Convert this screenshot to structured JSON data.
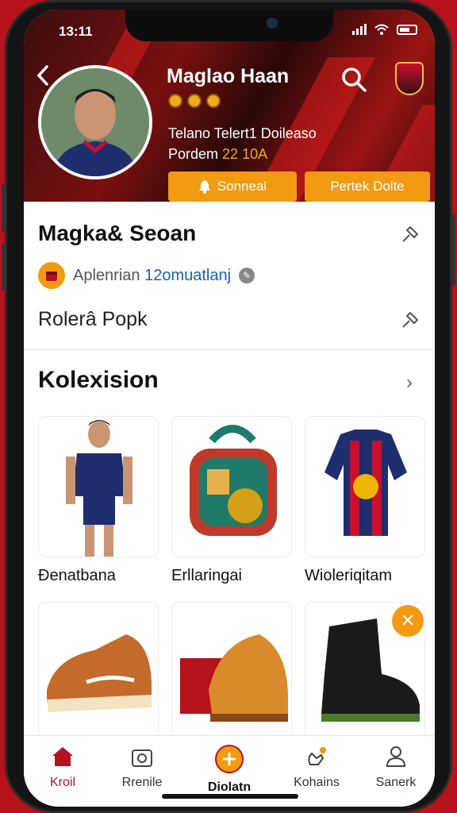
{
  "status": {
    "time": "13:11"
  },
  "profile": {
    "name": "Maglao Haan",
    "info_line1": "Telano Telert1 Doileaso",
    "info_label": "Pordem",
    "info_value": "22 10A",
    "primary_button": "Sonneal",
    "secondary_button": "Pertek Dolte"
  },
  "detail": {
    "title": "Magka& Seoan",
    "meta_label": "Aplenrian",
    "meta_value": "12omuatlanj",
    "subtitle": "Rolerâ Popk"
  },
  "collection": {
    "title": "Kolexision",
    "items": [
      {
        "label": "Đenatbana",
        "icon": "player-image"
      },
      {
        "label": "Erllaringai",
        "icon": "medal-bag-image"
      },
      {
        "label": "Wioleriqitam",
        "icon": "jersey-image"
      },
      {
        "label": "",
        "icon": "sneaker-image"
      },
      {
        "label": "",
        "icon": "boots-box-image"
      },
      {
        "label": "",
        "icon": "black-boot-image"
      }
    ]
  },
  "tabs": [
    {
      "label": "Kroil",
      "icon": "home-icon",
      "active": true
    },
    {
      "label": "Rrenile",
      "icon": "camera-icon",
      "active": false
    },
    {
      "label": "Diolatn",
      "icon": "plus-circle-icon",
      "active": false
    },
    {
      "label": "Kohains",
      "icon": "hand-bell-icon",
      "active": false
    },
    {
      "label": "Sanerk",
      "icon": "person-icon",
      "active": false
    }
  ],
  "colors": {
    "accent": "#f29a12",
    "brand": "#b5121b",
    "link": "#1f5fb3"
  }
}
